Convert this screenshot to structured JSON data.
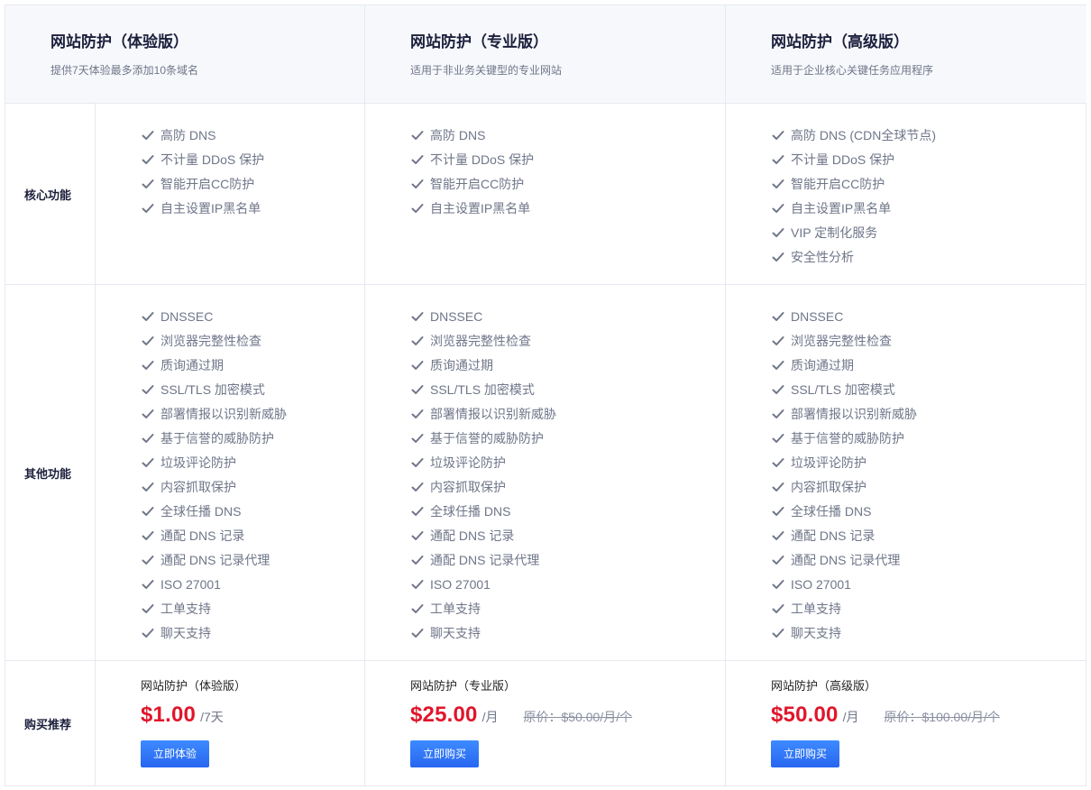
{
  "plans": [
    {
      "title": "网站防护（体验版）",
      "desc": "提供7天体验最多添加10条域名"
    },
    {
      "title": "网站防护（专业版）",
      "desc": "适用于非业务关键型的专业网站"
    },
    {
      "title": "网站防护（高级版）",
      "desc": "适用于企业核心关键任务应用程序"
    }
  ],
  "labels": {
    "core": "核心功能",
    "other": "其他功能",
    "buy": "购买推荐"
  },
  "core": [
    [
      "高防 DNS",
      "不计量 DDoS 保护",
      "智能开启CC防护",
      "自主设置IP黑名单"
    ],
    [
      "高防 DNS",
      "不计量 DDoS 保护",
      "智能开启CC防护",
      "自主设置IP黑名单"
    ],
    [
      "高防 DNS (CDN全球节点)",
      "不计量 DDoS 保护",
      "智能开启CC防护",
      "自主设置IP黑名单",
      "VIP 定制化服务",
      "安全性分析"
    ]
  ],
  "other": [
    [
      "DNSSEC",
      "浏览器完整性检查",
      "质询通过期",
      "SSL/TLS 加密模式",
      "部署情报以识别新威胁",
      "基于信誉的威胁防护",
      "垃圾评论防护",
      "内容抓取保护",
      "全球任播 DNS",
      "通配 DNS 记录",
      "通配 DNS 记录代理",
      "ISO 27001",
      "工单支持",
      "聊天支持"
    ],
    [
      "DNSSEC",
      "浏览器完整性检查",
      "质询通过期",
      "SSL/TLS 加密模式",
      "部署情报以识别新威胁",
      "基于信誉的威胁防护",
      "垃圾评论防护",
      "内容抓取保护",
      "全球任播 DNS",
      "通配 DNS 记录",
      "通配 DNS 记录代理",
      "ISO 27001",
      "工单支持",
      "聊天支持"
    ],
    [
      "DNSSEC",
      "浏览器完整性检查",
      "质询通过期",
      "SSL/TLS 加密模式",
      "部署情报以识别新威胁",
      "基于信誉的威胁防护",
      "垃圾评论防护",
      "内容抓取保护",
      "全球任播 DNS",
      "通配 DNS 记录",
      "通配 DNS 记录代理",
      "ISO 27001",
      "工单支持",
      "聊天支持"
    ]
  ],
  "buy": [
    {
      "name": "网站防护（体验版）",
      "price": "$1.00",
      "unit": "/7天",
      "original": "",
      "button": "立即体验"
    },
    {
      "name": "网站防护（专业版）",
      "price": "$25.00",
      "unit": "/月",
      "original": "原价：$50.00/月/个",
      "button": "立即购买"
    },
    {
      "name": "网站防护（高级版）",
      "price": "$50.00",
      "unit": "/月",
      "original": "原价：$100.00/月/个",
      "button": "立即购买"
    }
  ],
  "icons": {
    "check": "check-icon"
  },
  "colors": {
    "price": "#e0162b",
    "button": "#2f72f6",
    "check": "#6f7689"
  }
}
